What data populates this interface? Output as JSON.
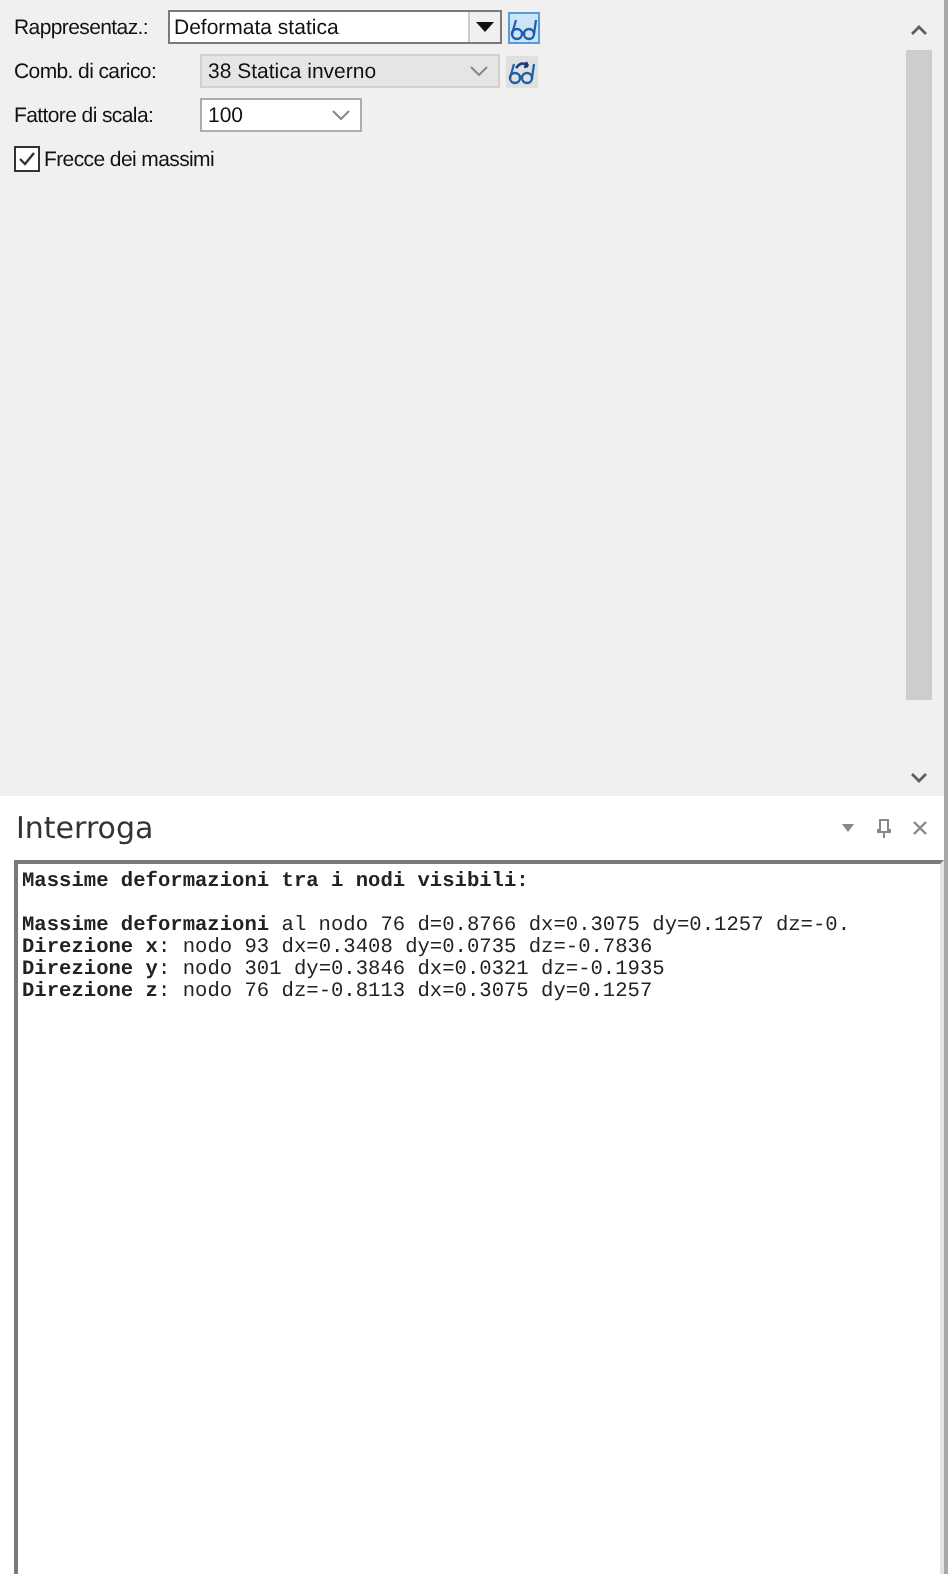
{
  "properties": {
    "rows": [
      {
        "kind": "editable",
        "label": "Rappresentaz.:",
        "value": "Deformata statica",
        "button_active": true
      },
      {
        "kind": "dropdown",
        "label": "Comb. di carico:",
        "value": "38 Statica inverno",
        "button_active": false
      },
      {
        "kind": "small",
        "label": "Fattore di scala:",
        "value": "100"
      },
      {
        "kind": "checkbox",
        "label": "Frecce dei massimi",
        "checked": true
      }
    ]
  },
  "query_panel": {
    "title": "Interroga",
    "output": [
      {
        "text": "**Massime deformazioni tra i nodi visibili:**",
        "gap_after": true
      },
      "**Massime deformazioni** al nodo 76 d=0.8766 dx=0.3075 dy=0.1257 dz=-0.",
      "**Direzione x**: nodo 93 dx=0.3408 dy=0.0735 dz=-0.7836",
      "**Direzione y**: nodo 301 dy=0.3846 dx=0.0321 dz=-0.1935",
      "**Direzione z**: nodo 76 dz=-0.8113 dx=0.3075 dy=0.1257"
    ]
  }
}
